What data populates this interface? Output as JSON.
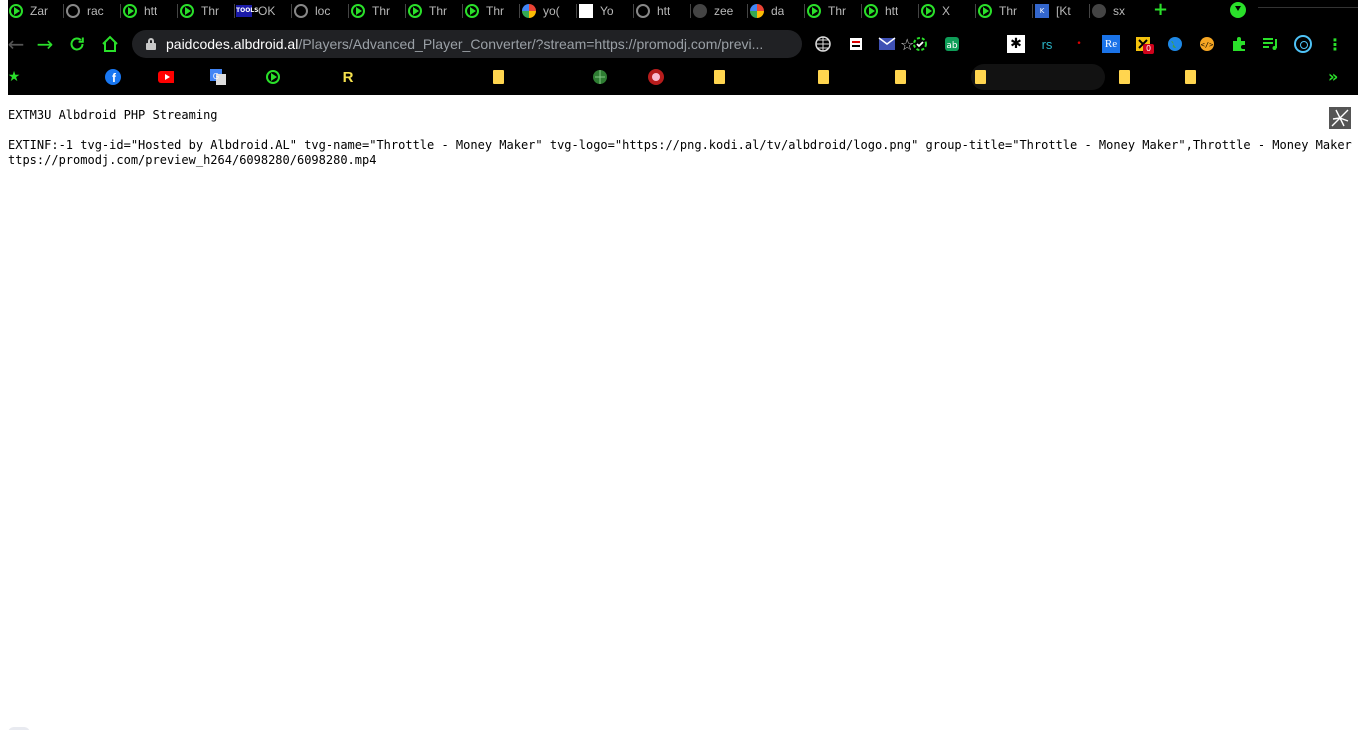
{
  "tabs": [
    {
      "icon": "play-icon",
      "title": "Zar"
    },
    {
      "icon": "globe-icon",
      "title": "rac"
    },
    {
      "icon": "play-icon",
      "title": "htt"
    },
    {
      "icon": "play-icon",
      "title": "Thr"
    },
    {
      "icon": "tools-icon",
      "title": "OK"
    },
    {
      "icon": "globe-icon",
      "title": "loc"
    },
    {
      "icon": "play-icon",
      "title": "Thr"
    },
    {
      "icon": "play-icon",
      "title": "Thr"
    },
    {
      "icon": "play-icon",
      "title": "Thr"
    },
    {
      "icon": "google-icon",
      "title": "yo("
    },
    {
      "icon": "blank-page-icon",
      "title": "Yo"
    },
    {
      "icon": "globe-icon",
      "title": "htt"
    },
    {
      "icon": "github-icon",
      "title": "zee"
    },
    {
      "icon": "google-icon",
      "title": "da"
    },
    {
      "icon": "play-icon",
      "title": "Thr"
    },
    {
      "icon": "play-icon",
      "title": "htt"
    },
    {
      "icon": "play-icon",
      "title": "X"
    },
    {
      "icon": "play-icon",
      "title": "Thr"
    },
    {
      "icon": "app-icon",
      "title": "[Kt"
    },
    {
      "icon": "github-icon",
      "title": "sx"
    }
  ],
  "new_tab_label": "+",
  "address_bar": {
    "host": "paidcodes.albdroid.al",
    "path": "/Players/Advanced_Player_Converter/?stream=https://promodj.com/previ..."
  },
  "extensions": {
    "rs_label": "rs",
    "re_label": "Re",
    "badge_count": "0"
  },
  "bookmarks_overflow": "»",
  "page": {
    "header_line": "EXTM3U Albdroid PHP Streaming",
    "extinf_line": "EXTINF:-1 tvg-id=\"Hosted by Albdroid.AL\" tvg-name=\"Throttle - Money Maker\" tvg-logo=\"https://png.kodi.al/tv/albdroid/logo.png\" group-title=\"Throttle - Money Maker\",Throttle - Money Maker",
    "stream_url_line": "ttps://promodj.com/preview_h264/6098280/6098280.mp4"
  },
  "colors": {
    "accent_green": "#2ae02a",
    "chrome_bg": "#000000",
    "omnibox_bg": "#202124",
    "folder_yellow": "#ffd54f"
  }
}
